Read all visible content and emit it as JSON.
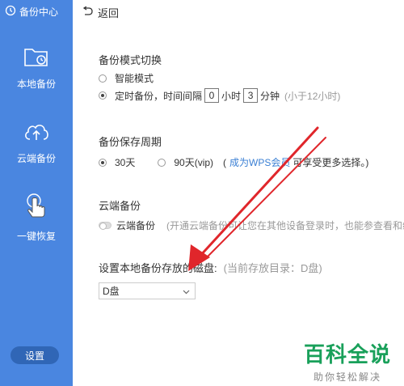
{
  "sidebar": {
    "title": "备份中心",
    "items": [
      {
        "label": "本地备份",
        "icon": "folder-clock-icon"
      },
      {
        "label": "云端备份",
        "icon": "cloud-upload-icon"
      },
      {
        "label": "一键恢复",
        "icon": "hand-pointer-icon"
      }
    ],
    "settings_label": "设置"
  },
  "topbar": {
    "back_label": "返回",
    "icon": "undo-arrow-icon"
  },
  "backup_mode": {
    "title": "备份模式切换",
    "smart_label": "智能模式",
    "scheduled_label": "定时备份，时间间隔",
    "hours_value": "0",
    "hours_unit": "小时",
    "minutes_value": "3",
    "minutes_unit": "分钟",
    "hint": "(小于12小时)"
  },
  "retention": {
    "title": "备份保存周期",
    "opt1_label": "30天",
    "opt2_label": "90天(vip)",
    "paren_open": "(",
    "link_text": "成为WPS会员",
    "suffix": "可享受更多选择。)"
  },
  "cloud_backup": {
    "title": "云端备份",
    "toggle_label": "云端备份",
    "description": "(开通云端备份可让您在其他设备登录时，也能参查看和编辑"
  },
  "disk": {
    "title": "设置本地备份存放的磁盘:",
    "current": "(当前存放目录：D盘)",
    "selected": "D盘"
  },
  "watermark": {
    "brand": "百科全说",
    "slogan": "助你轻松解决"
  },
  "colors": {
    "sidebar": "#4a86e0",
    "accent_link": "#3a7fd4",
    "arrow": "#e0262b",
    "brand": "#19a05a"
  }
}
